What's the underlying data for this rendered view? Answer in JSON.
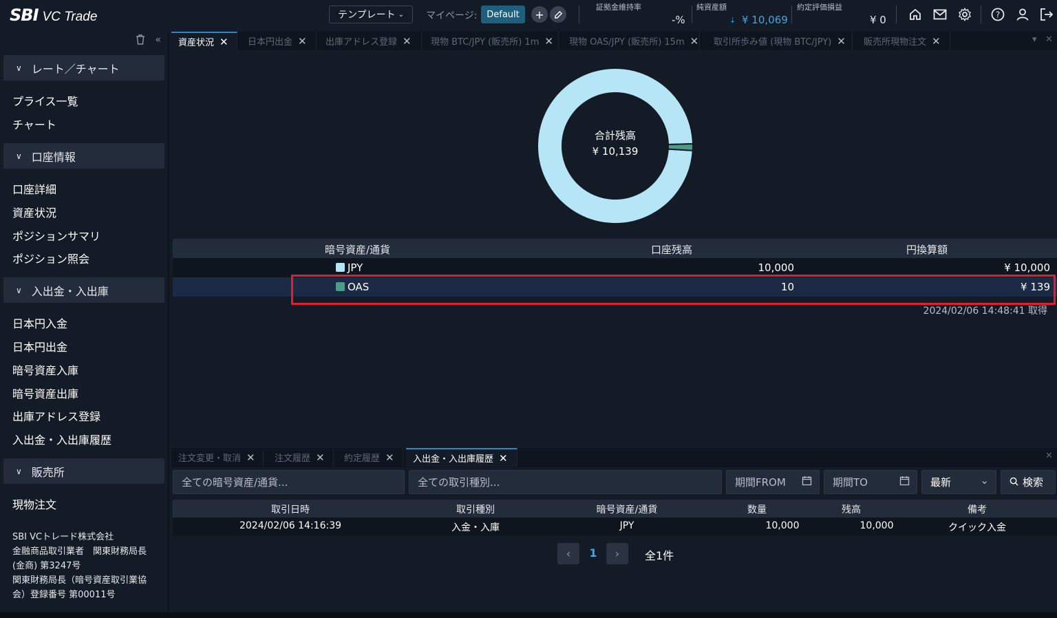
{
  "header": {
    "logo_sbi": "SBI",
    "logo_vc": "VC Trade",
    "template_label": "テンプレート",
    "mypage_label": "マイページ:",
    "default_label": "Default",
    "margin_rate_label": "証拠金維持率",
    "margin_rate_value": "-%",
    "net_assets_label": "純資産額",
    "net_assets_value": "¥ 10,069",
    "unrealized_pl_label": "約定評価損益",
    "unrealized_pl_value": "¥ 0"
  },
  "sidebar": {
    "sections": [
      {
        "title": "レート／チャート",
        "items": [
          "プライス一覧",
          "チャート"
        ]
      },
      {
        "title": "口座情報",
        "items": [
          "口座詳細",
          "資産状況",
          "ポジションサマリ",
          "ポジション照会"
        ]
      },
      {
        "title": "入出金・入出庫",
        "items": [
          "日本円入金",
          "日本円出金",
          "暗号資産入庫",
          "暗号資産出庫",
          "出庫アドレス登録",
          "入出金・入出庫履歴"
        ]
      },
      {
        "title": "販売所",
        "items": [
          "現物注文"
        ]
      }
    ],
    "company": {
      "line1": "SBI VCトレード株式会社",
      "line2": "金融商品取引業者　関東財務局長",
      "line3": "(金商) 第3247号",
      "line4": "関東財務局長（暗号資産取引業協",
      "line5": "会）登録番号 第00011号"
    }
  },
  "tabs": [
    "資産状況",
    "日本円出金",
    "出庫アドレス登録",
    "現物 BTC/JPY (販売所) 1m",
    "現物 OAS/JPY (販売所) 15m",
    "取引所歩み値 (現物 BTC/JPY)",
    "販売所現物注文"
  ],
  "chart_data": {
    "type": "pie",
    "title": "合計残高",
    "total_label": "¥ 10,139",
    "categories": [
      "JPY",
      "OAS"
    ],
    "values": [
      10000,
      139
    ],
    "colors": [
      "#b6e5f5",
      "#4e9b8a"
    ]
  },
  "assets_table": {
    "headers": [
      "暗号資産/通貨",
      "口座残高",
      "円換算額"
    ],
    "rows": [
      {
        "name": "JPY",
        "balance": "10,000",
        "jpy": "¥ 10,000",
        "color": "#b6e5f5"
      },
      {
        "name": "OAS",
        "balance": "10",
        "jpy": "¥ 139",
        "color": "#4e9b8a"
      }
    ],
    "timestamp": "2024/02/06 14:48:41 取得"
  },
  "bottom_tabs": [
    "注文変更・取消",
    "注文履歴",
    "約定履歴",
    "入出金・入出庫履歴"
  ],
  "filters": {
    "asset_placeholder": "全ての暗号資産/通貨...",
    "type_placeholder": "全ての取引種別...",
    "from_label": "期間FROM",
    "to_label": "期間TO",
    "sort_value": "最新",
    "search_label": "検索"
  },
  "history_table": {
    "headers": [
      "取引日時",
      "取引種別",
      "暗号資産/通貨",
      "数量",
      "残高",
      "備考"
    ],
    "rows": [
      {
        "datetime": "2024/02/06 14:16:39",
        "type": "入金・入庫",
        "asset": "JPY",
        "qty": "10,000",
        "balance": "10,000",
        "note": "クイック入金"
      }
    ]
  },
  "pagination": {
    "current": "1",
    "total": "全1件"
  }
}
